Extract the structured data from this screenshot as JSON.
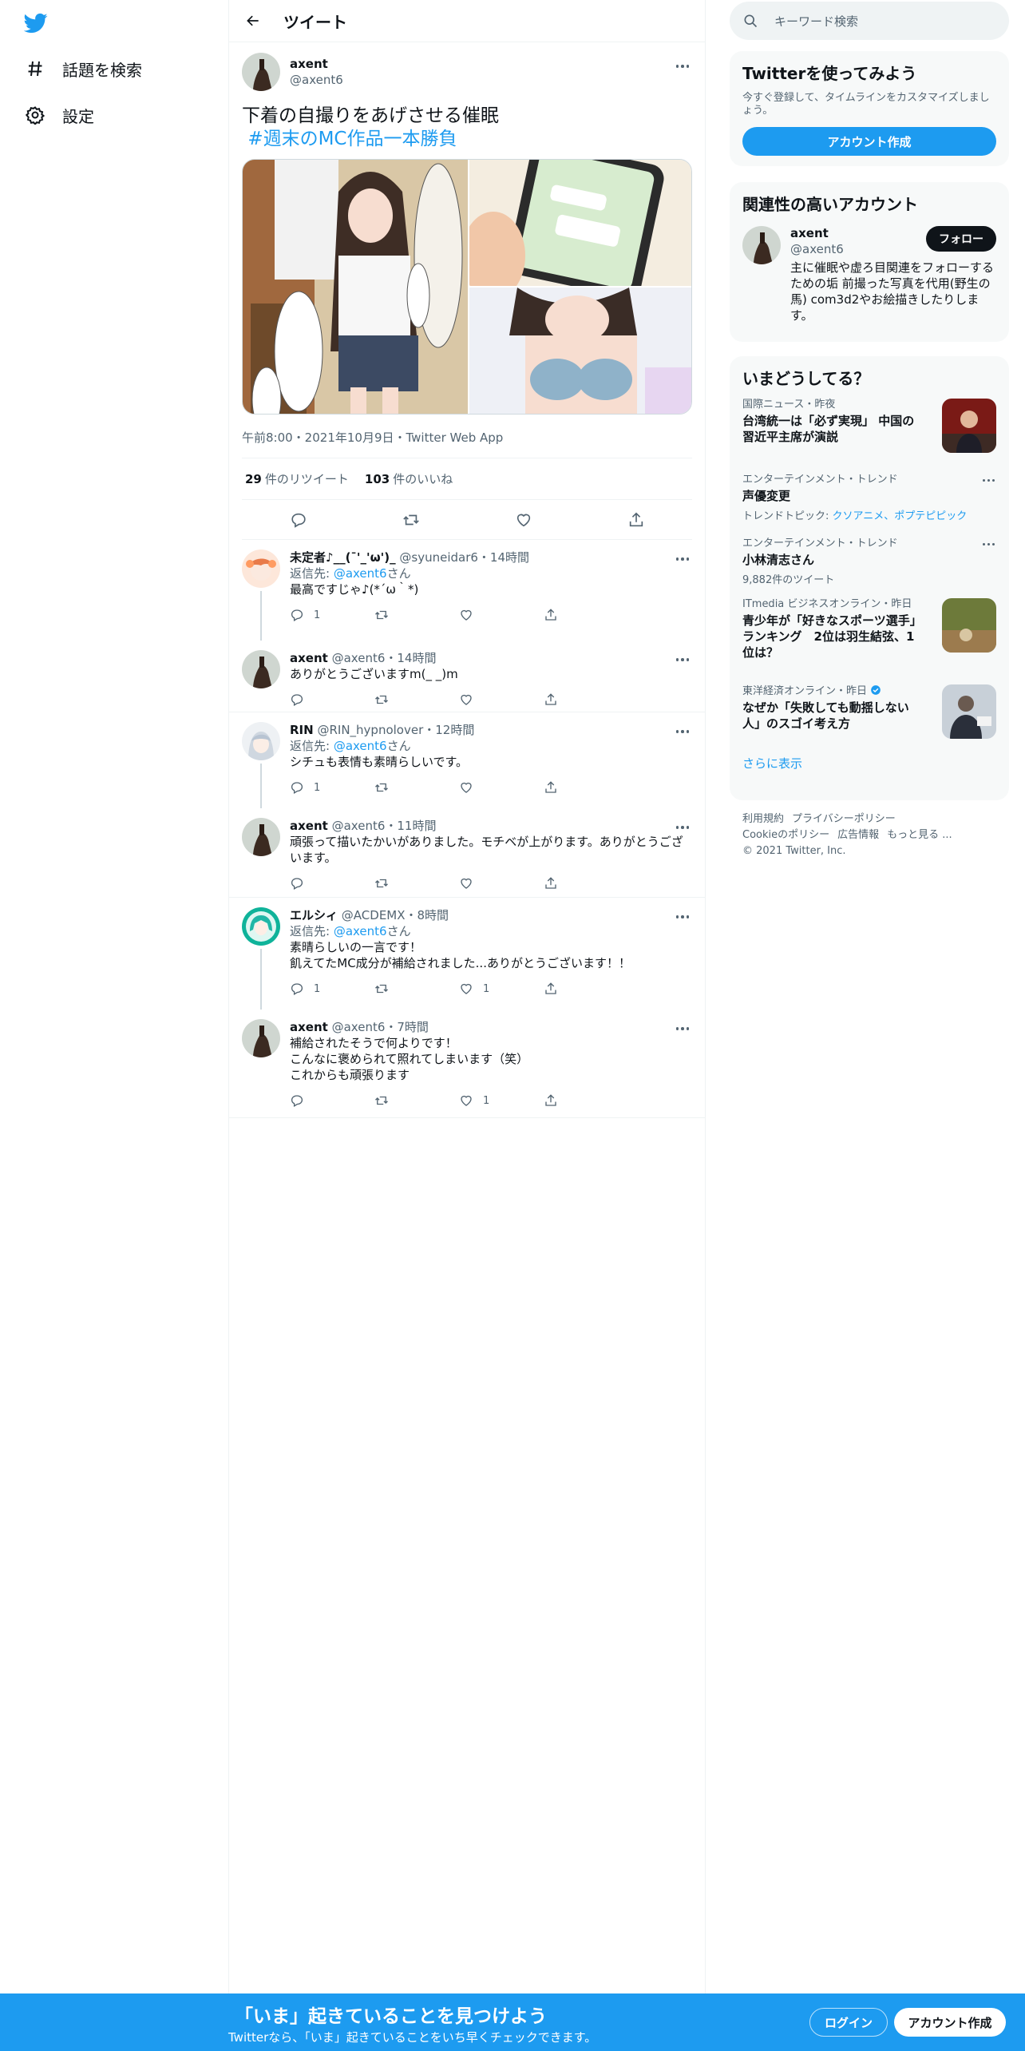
{
  "nav": {
    "explore_label": "話題を検索",
    "settings_label": "設定"
  },
  "header": {
    "title": "ツイート"
  },
  "tweet": {
    "author_name": "axent",
    "author_handle": "@axent6",
    "text_line1": "下着の自撮りをあげさせる催眠",
    "hashtag": "#週末のMC作品一本勝負",
    "meta": "午前8:00・2021年10月9日・Twitter Web App",
    "retweets_count": "29",
    "retweets_label": "件のリツイート",
    "likes_count": "103",
    "likes_label": "件のいいね"
  },
  "replies": [
    {
      "name": "未定者♪__(¯'_'ω')_",
      "handle": "@syuneidar6",
      "time": "・14時間",
      "reply_to_prefix": "返信先: ",
      "reply_to": "@axent6",
      "reply_to_suffix": "さん",
      "text": "最高ですじゃ♪(*´ω｀*)",
      "reply_count": "1",
      "retweet_count": "",
      "like_count": ""
    },
    {
      "name": "axent",
      "handle": "@axent6",
      "time": "・14時間",
      "reply_to_prefix": "",
      "reply_to": "",
      "reply_to_suffix": "",
      "text": "ありがとうございますm(_ _)m",
      "reply_count": "",
      "retweet_count": "",
      "like_count": ""
    },
    {
      "name": "RIN",
      "handle": "@RIN_hypnolover",
      "time": "・12時間",
      "reply_to_prefix": "返信先: ",
      "reply_to": "@axent6",
      "reply_to_suffix": "さん",
      "text": "シチュも表情も素晴らしいです。",
      "reply_count": "1",
      "retweet_count": "",
      "like_count": ""
    },
    {
      "name": "axent",
      "handle": "@axent6",
      "time": "・11時間",
      "reply_to_prefix": "",
      "reply_to": "",
      "reply_to_suffix": "",
      "text": "頑張って描いたかいがありました。モチベが上がります。ありがとうございます。",
      "reply_count": "",
      "retweet_count": "",
      "like_count": ""
    },
    {
      "name": "エルシィ",
      "handle": "@ACDEMX",
      "time": "・8時間",
      "reply_to_prefix": "返信先: ",
      "reply_to": "@axent6",
      "reply_to_suffix": "さん",
      "text": "素晴らしいの一言です！\n飢えてたMC成分が補給されました...ありがとうございます！！",
      "reply_count": "1",
      "retweet_count": "",
      "like_count": "1"
    },
    {
      "name": "axent",
      "handle": "@axent6",
      "time": "・7時間",
      "reply_to_prefix": "",
      "reply_to": "",
      "reply_to_suffix": "",
      "text": "補給されたそうで何よりです！\nこんなに褒められて照れてしまいます（笑）\nこれからも頑張ります",
      "reply_count": "",
      "retweet_count": "",
      "like_count": "1"
    }
  ],
  "sidebar": {
    "search_placeholder": "キーワード検索",
    "signup": {
      "title": "Twitterを使ってみよう",
      "subtitle": "今すぐ登録して、タイムラインをカスタマイズしましょう。",
      "button": "アカウント作成"
    },
    "related": {
      "title": "関連性の高いアカウント",
      "name": "axent",
      "handle": "@axent6",
      "follow": "フォロー",
      "bio": "主に催眠や虚ろ目関連をフォローするための垢 前撮った写真を代用(野生の馬) com3d2やお絵描きしたりします。"
    },
    "trends": {
      "title": "いまどうしてる？",
      "items": [
        {
          "meta": "国際ニュース・昨夜",
          "title": "台湾統一は「必ず実現」 中国の習近平主席が演説",
          "sub": "",
          "sub_links": ""
        },
        {
          "meta": "エンターテインメント・トレンド",
          "title": "声優変更",
          "sub": "トレンドトピック: ",
          "sub_links": "クソアニメ、ポプテピピック"
        },
        {
          "meta": "エンターテインメント・トレンド",
          "title": "小林清志さん",
          "sub": "9,882件のツイート",
          "sub_links": ""
        },
        {
          "meta": "ITmedia ビジネスオンライン・昨日",
          "title": "青少年が「好きなスポーツ選手」ランキング　2位は羽生結弦、1位は？",
          "sub": "",
          "sub_links": ""
        },
        {
          "meta": "東洋経済オンライン・昨日",
          "title": "なぜか「失敗しても動揺しない人」のスゴイ考え方",
          "sub": "",
          "sub_links": ""
        }
      ],
      "show_more": "さらに表示"
    },
    "footer": {
      "terms": "利用規約",
      "privacy": "プライバシーポリシー",
      "cookie": "Cookieのポリシー",
      "ads": "広告情報",
      "more": "もっと見る ...",
      "copyright": "© 2021 Twitter, Inc."
    }
  },
  "bottom_bar": {
    "title": "「いま」起きていることを見つけよう",
    "subtitle": "Twitterなら、「いま」起きていることをいち早くチェックできます。",
    "login": "ログイン",
    "signup": "アカウント作成"
  },
  "colors": {
    "accent": "#1d9bf0",
    "text": "#0f1419",
    "secondary": "#536471"
  },
  "icons": [
    "twitter-logo-icon",
    "hashtag-icon",
    "gear-icon",
    "back-arrow-icon",
    "more-icon",
    "reply-icon",
    "retweet-icon",
    "like-icon",
    "share-icon",
    "search-icon",
    "verified-icon"
  ]
}
